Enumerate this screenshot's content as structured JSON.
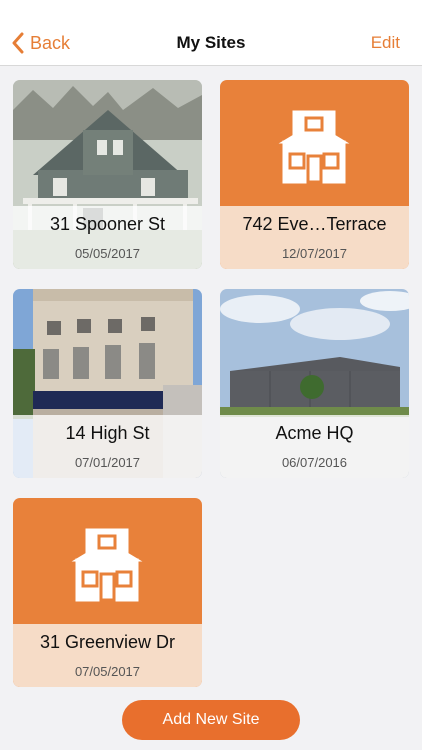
{
  "header": {
    "back_label": "Back",
    "title": "My Sites",
    "edit_label": "Edit"
  },
  "sites": [
    {
      "name": "31 Spooner St",
      "date": "05/05/2017",
      "image": "house-photo"
    },
    {
      "name": "742 Eve…Terrace",
      "date": "12/07/2017",
      "image": "placeholder-house-icon"
    },
    {
      "name": "14 High St",
      "date": "07/01/2017",
      "image": "building-photo"
    },
    {
      "name": "Acme HQ",
      "date": "06/07/2016",
      "image": "warehouse-photo"
    },
    {
      "name": "31 Greenview Dr",
      "date": "07/05/2017",
      "image": "placeholder-house-icon"
    }
  ],
  "footer": {
    "add_label": "Add New Site"
  },
  "colors": {
    "accent": "#e67e36",
    "placeholder_bg": "#e8813a",
    "caption_placeholder": "#f6dcc7",
    "button": "#e86f2d"
  }
}
